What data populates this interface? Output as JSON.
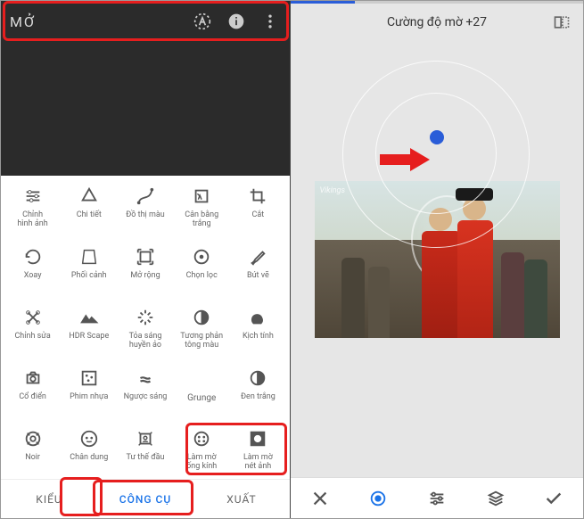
{
  "title": "MỞ",
  "tools": [
    {
      "id": "tune",
      "label": "Chỉnh\nhình ảnh"
    },
    {
      "id": "details",
      "label": "Chi tiết"
    },
    {
      "id": "curves",
      "label": "Đồ thị màu"
    },
    {
      "id": "whitebalance",
      "label": "Cân bằng\ntrắng"
    },
    {
      "id": "crop",
      "label": "Cắt"
    },
    {
      "id": "rotate",
      "label": "Xoay"
    },
    {
      "id": "perspective",
      "label": "Phối cảnh"
    },
    {
      "id": "expand",
      "label": "Mở rộng"
    },
    {
      "id": "selective",
      "label": "Chọn lọc"
    },
    {
      "id": "brush",
      "label": "Bút vẽ"
    },
    {
      "id": "healing",
      "label": "Chỉnh sửa"
    },
    {
      "id": "hdr",
      "label": "HDR Scape"
    },
    {
      "id": "glamour",
      "label": "Tỏa sáng\nhuyền ảo"
    },
    {
      "id": "tonal",
      "label": "Tương phản\ntông màu"
    },
    {
      "id": "drama",
      "label": "Kịch tính"
    },
    {
      "id": "vintage",
      "label": "Cổ điển"
    },
    {
      "id": "grainy",
      "label": "Phim nhựa"
    },
    {
      "id": "retrolux",
      "label": "Ngược sáng"
    },
    {
      "id": "grunge",
      "label": "Grunge"
    },
    {
      "id": "bw",
      "label": "Đen trắng"
    },
    {
      "id": "noir",
      "label": "Noir"
    },
    {
      "id": "portrait",
      "label": "Chân dung"
    },
    {
      "id": "headpose",
      "label": "Tư thế đầu"
    },
    {
      "id": "lensblur",
      "label": "Làm mờ\nống kính"
    },
    {
      "id": "vignette",
      "label": "Làm mờ\nnét ảnh"
    }
  ],
  "tabs": {
    "styles": "KIỂU",
    "tools": "CÔNG CỤ",
    "export": "XUẤT",
    "active": "tools"
  },
  "editor": {
    "slider_label": "Cường độ mờ +27",
    "progress_pct": 22
  }
}
